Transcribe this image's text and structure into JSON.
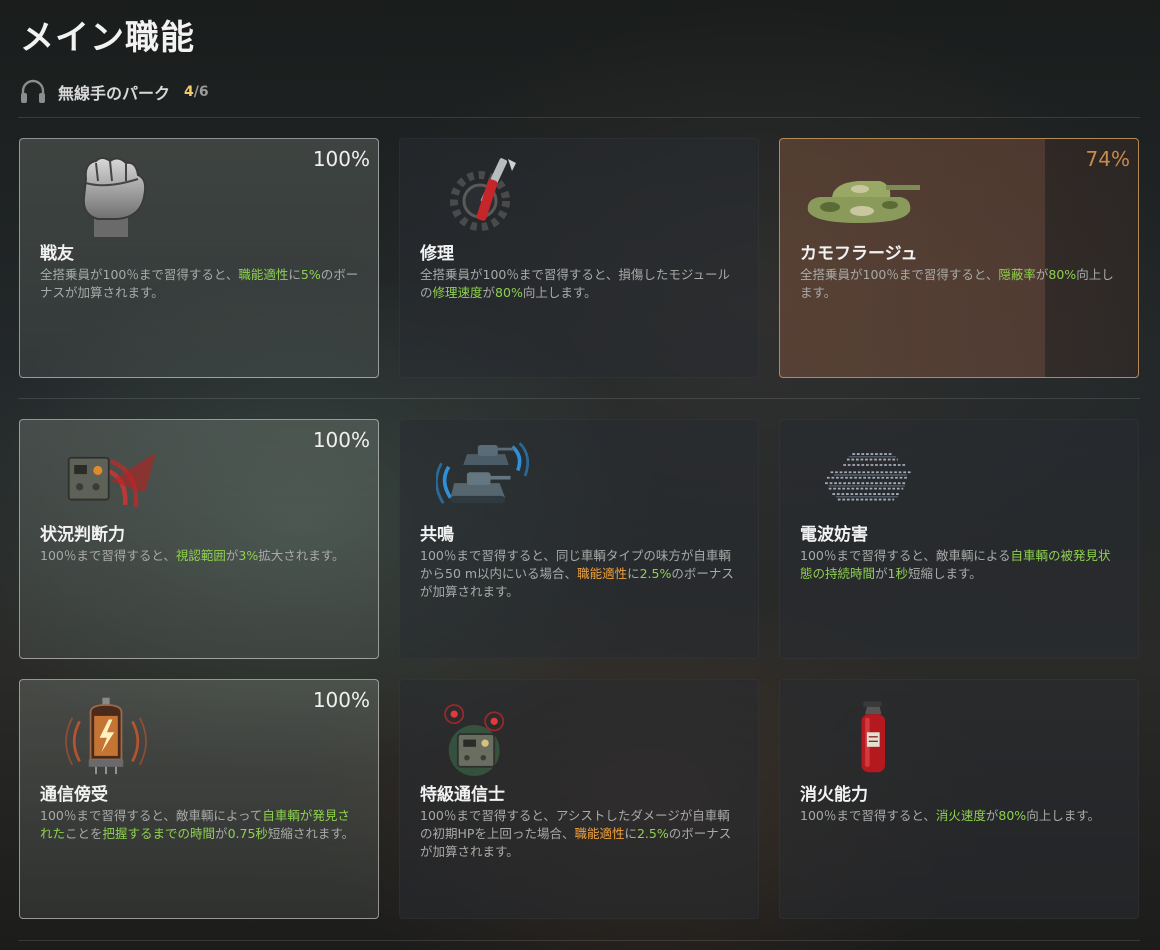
{
  "page": {
    "title": "メイン職能"
  },
  "section": {
    "title": "無線手のパーク",
    "count_current": "4",
    "count_sep": "/",
    "count_total": "6",
    "icon": "headset-icon"
  },
  "colors": {
    "highlight_green": "#8fd14f",
    "highlight_orange": "#f3a13b",
    "partial_progress": "#c98a4a",
    "counter_gold": "#f3c96b"
  },
  "perks": [
    {
      "name": "戦友",
      "icon": "fist-icon",
      "status": "learned",
      "percent": "100%",
      "progress": 1.0,
      "desc": [
        {
          "t": "全搭乗員が100％まで習得すると、"
        },
        {
          "t": "職能適性",
          "c": "green"
        },
        {
          "t": "に"
        },
        {
          "t": "5%",
          "c": "green"
        },
        {
          "t": "のボーナスが加算されます。"
        }
      ]
    },
    {
      "name": "修理",
      "icon": "repair-tools-icon",
      "status": "locked",
      "percent": "",
      "progress": 0,
      "desc": [
        {
          "t": "全搭乗員が100％まで習得すると、損傷したモジュールの"
        },
        {
          "t": "修理速度",
          "c": "green"
        },
        {
          "t": "が"
        },
        {
          "t": "80%",
          "c": "green"
        },
        {
          "t": "向上します。"
        }
      ]
    },
    {
      "name": "カモフラージュ",
      "icon": "camouflage-tank-icon",
      "status": "partial",
      "percent": "74%",
      "progress": 0.74,
      "desc": [
        {
          "t": "全搭乗員が100％まで習得すると、"
        },
        {
          "t": "隠蔽率",
          "c": "green"
        },
        {
          "t": "が"
        },
        {
          "t": "80%",
          "c": "green"
        },
        {
          "t": "向上します。"
        }
      ]
    },
    {
      "name": "状況判断力",
      "icon": "radio-signal-icon",
      "status": "learned",
      "percent": "100%",
      "progress": 1.0,
      "desc": [
        {
          "t": "100％まで習得すると、"
        },
        {
          "t": "視認範囲",
          "c": "green"
        },
        {
          "t": "が"
        },
        {
          "t": "3%",
          "c": "green"
        },
        {
          "t": "拡大されます。"
        }
      ]
    },
    {
      "name": "共鳴",
      "icon": "resonating-tanks-icon",
      "status": "locked",
      "percent": "",
      "progress": 0,
      "desc": [
        {
          "t": "100％まで習得すると、同じ車輌タイプの味方が自車輌から50 m以内にいる場合、"
        },
        {
          "t": "職能適性",
          "c": "orange"
        },
        {
          "t": "に"
        },
        {
          "t": "2.5%",
          "c": "green"
        },
        {
          "t": "のボーナスが加算されます。"
        }
      ]
    },
    {
      "name": "電波妨害",
      "icon": "jammed-tank-icon",
      "status": "locked",
      "percent": "",
      "progress": 0,
      "desc": [
        {
          "t": "100％まで習得すると、敵車輌による"
        },
        {
          "t": "自車輌の被発見状態の持続時間",
          "c": "green"
        },
        {
          "t": "が"
        },
        {
          "t": "1秒",
          "c": "green"
        },
        {
          "t": "短縮します。"
        }
      ]
    },
    {
      "name": "通信傍受",
      "icon": "vacuum-tube-icon",
      "status": "learned",
      "percent": "100%",
      "progress": 1.0,
      "desc": [
        {
          "t": "100％まで習得すると、敵車輌によって"
        },
        {
          "t": "自車輌が発見された",
          "c": "green"
        },
        {
          "t": "ことを"
        },
        {
          "t": "把握するまでの時間",
          "c": "green"
        },
        {
          "t": "が"
        },
        {
          "t": "0.75秒",
          "c": "green"
        },
        {
          "t": "短縮されます。"
        }
      ]
    },
    {
      "name": "特級通信士",
      "icon": "radio-beacons-icon",
      "status": "locked",
      "percent": "",
      "progress": 0,
      "desc": [
        {
          "t": "100％まで習得すると、アシストしたダメージが自車輌の初期HPを上回った場合、"
        },
        {
          "t": "職能適性",
          "c": "orange"
        },
        {
          "t": "に"
        },
        {
          "t": "2.5%",
          "c": "green"
        },
        {
          "t": "のボーナスが加算されます。"
        }
      ]
    },
    {
      "name": "消火能力",
      "icon": "fire-extinguisher-icon",
      "status": "locked",
      "percent": "",
      "progress": 0,
      "desc": [
        {
          "t": "100％まで習得すると、"
        },
        {
          "t": "消火速度",
          "c": "green"
        },
        {
          "t": "が"
        },
        {
          "t": "80%",
          "c": "green"
        },
        {
          "t": "向上します。"
        }
      ]
    }
  ]
}
